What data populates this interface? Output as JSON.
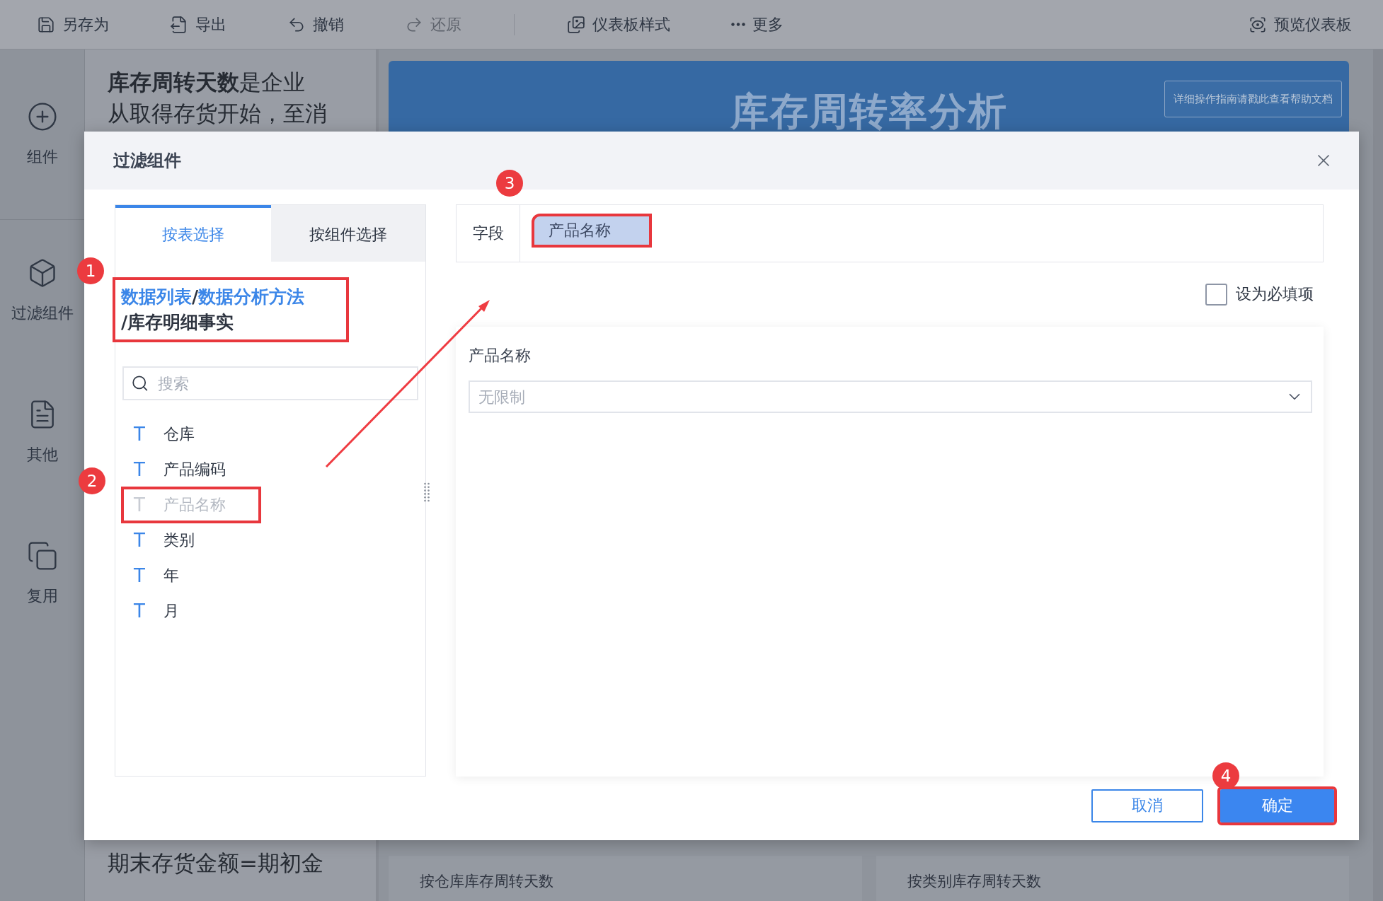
{
  "toolbar": {
    "items": [
      {
        "label": "另存为",
        "disabled": false
      },
      {
        "label": "导出",
        "disabled": false
      },
      {
        "label": "撤销",
        "disabled": false
      },
      {
        "label": "还原",
        "disabled": true
      },
      {
        "label": "仪表板样式",
        "disabled": false
      },
      {
        "label": "更多",
        "disabled": false
      }
    ],
    "preview": "预览仪表板"
  },
  "sidebar": {
    "items": [
      {
        "label": "组件"
      },
      {
        "label": "过滤组件"
      },
      {
        "label": "其他"
      },
      {
        "label": "复用"
      }
    ]
  },
  "text_panel": {
    "lines": [
      "**库存周转天数**是企业",
      "从取得存货开始，至消"
    ],
    "bottom_lines": [
      "期末存货金额=期初金"
    ]
  },
  "banner": {
    "title": "库存周转率分析",
    "help_button": "详细操作指南请戳此查看帮助文档"
  },
  "chart_titles": [
    "按仓库库存周转天数",
    "按类别库存周转天数"
  ],
  "dialog": {
    "title": "过滤组件",
    "tabs": [
      {
        "label": "按表选择",
        "selected": true
      },
      {
        "label": "按组件选择",
        "selected": false
      }
    ],
    "path": {
      "text": "**数据列表**/**数据分析方法**",
      "text_2": "/库存明细事实",
      "highlighted": true,
      "step": "1"
    },
    "search": {
      "placeholder": "搜索"
    },
    "fields": [
      {
        "type": "T",
        "label": "仓库",
        "disabled": false,
        "highlighted": false
      },
      {
        "type": "T",
        "label": "产品编码",
        "disabled": false,
        "highlighted": false
      },
      {
        "type": "T",
        "label": "产品名称",
        "disabled": true,
        "highlighted": true,
        "step": "2"
      },
      {
        "type": "T",
        "label": "类别",
        "disabled": false,
        "highlighted": false
      },
      {
        "type": "T",
        "label": "年",
        "disabled": false,
        "highlighted": false
      },
      {
        "type": "T",
        "label": "月",
        "disabled": false,
        "highlighted": false
      }
    ],
    "field_row": {
      "label": "字段",
      "tag": "产品名称",
      "highlighted": true,
      "step": "3"
    },
    "required": {
      "label": "设为必填项",
      "checked": false
    },
    "filter": {
      "label": "产品名称",
      "placeholder": "无限制"
    },
    "buttons": [
      {
        "label": "取消",
        "kind": "secondary",
        "highlighted": false
      },
      {
        "label": "确定",
        "kind": "primary",
        "highlighted": true,
        "step": "4"
      }
    ]
  }
}
